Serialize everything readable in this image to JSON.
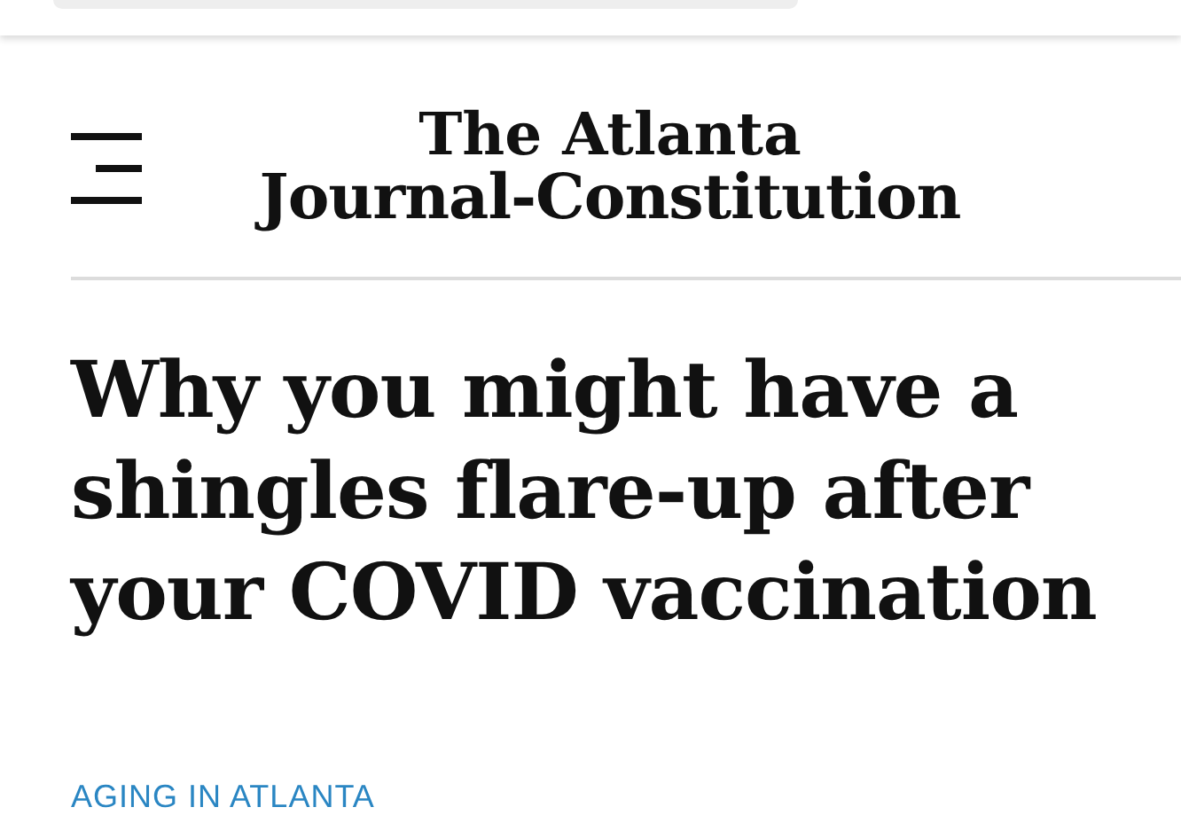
{
  "logo": {
    "line_1": "The Atlanta",
    "line_2": "Journal-Constitution"
  },
  "headline": "Why you might have a shingles flare-up after your COVID vaccination",
  "category": "AGING IN ATLANTA"
}
